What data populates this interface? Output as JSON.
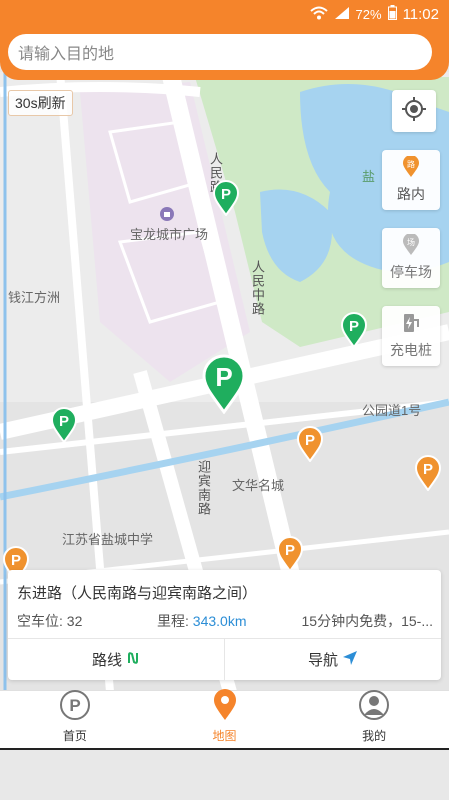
{
  "status_bar": {
    "battery": "72%",
    "time": "11:02"
  },
  "search": {
    "placeholder": "请输入目的地"
  },
  "map": {
    "refresh_label": "30s刷新",
    "labels": {
      "renmin_road_1": "人民路",
      "renmin_road_2": "人民中路",
      "baolong": "宝龙城市广场",
      "qianjiang": "钱江方洲",
      "gongyuan": "公园道1号",
      "yingbin": "迎宾南路",
      "wenhua": "文华名城",
      "school": "江苏省盐城中学",
      "yan": "盐"
    },
    "side_buttons": {
      "road": "路内",
      "parking": "停车场",
      "charging": "充电桩"
    },
    "colors": {
      "green_marker": "#1fae5e",
      "orange_marker": "#f0922e",
      "accent": "#f5842b"
    }
  },
  "info_card": {
    "title": "东进路（人民南路与迎宾南路之间）",
    "spaces_label": "空车位:",
    "spaces_value": "32",
    "distance_label": "里程:",
    "distance_value": "343.0km",
    "free_text": "15分钟内免费，15-...",
    "route_label": "路线",
    "nav_label": "导航"
  },
  "tabbar": {
    "home": "首页",
    "map": "地图",
    "mine": "我的"
  }
}
